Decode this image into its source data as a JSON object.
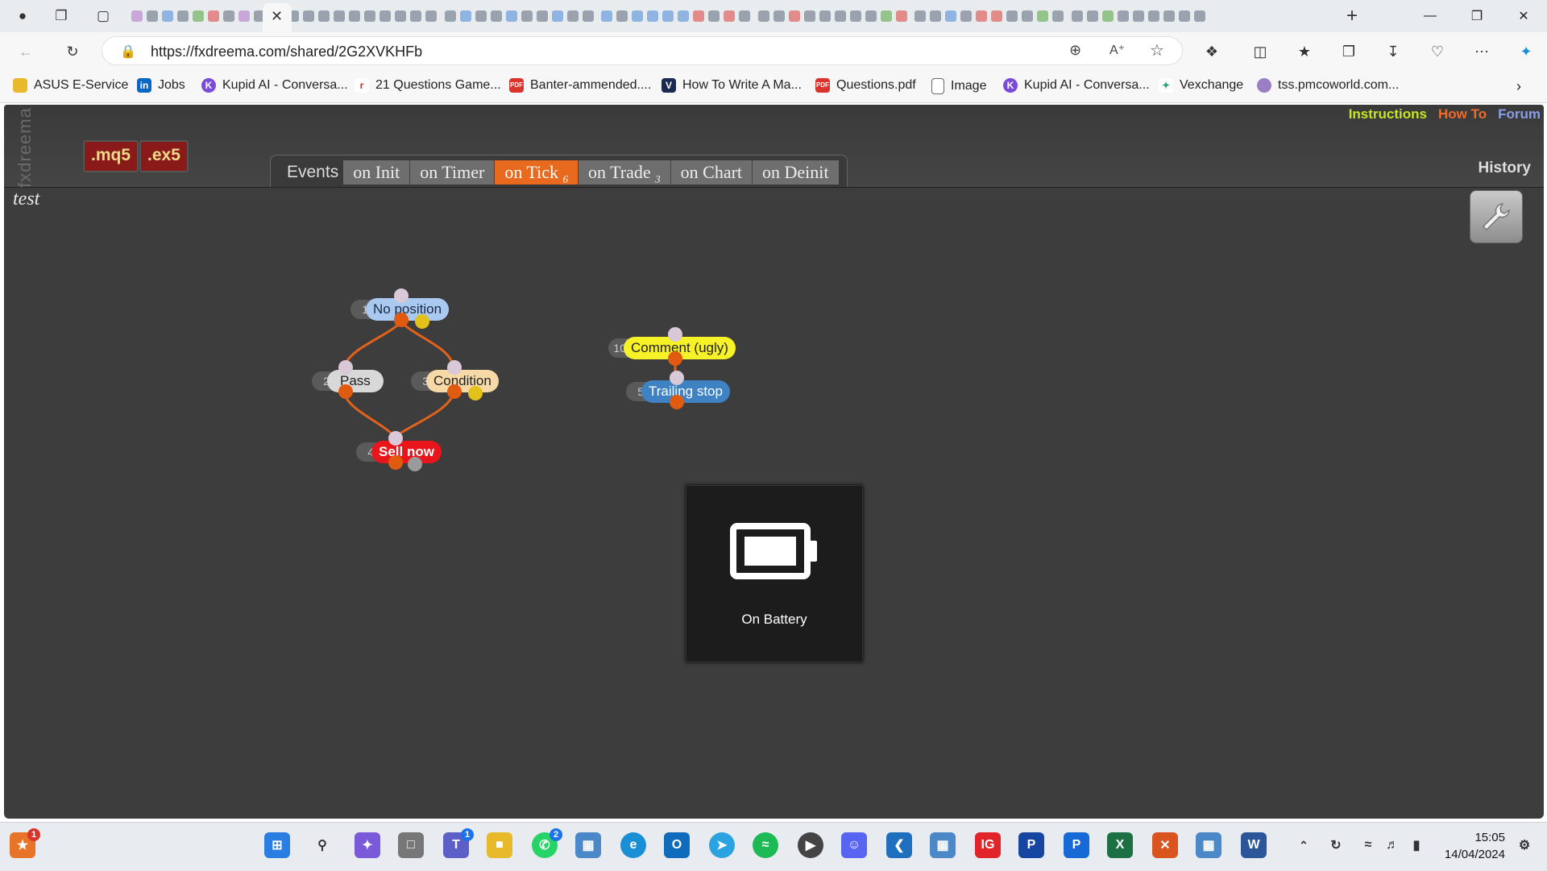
{
  "browser": {
    "url": "https://fxdreema.com/shared/2G2XVKHFb",
    "bookmarks": [
      {
        "label": "ASUS E-Service",
        "icon": "folder-icon",
        "color": "#e8b92b"
      },
      {
        "label": "Jobs",
        "icon": "linkedin-icon",
        "color": "#0a66c2"
      },
      {
        "label": "Kupid AI - Conversa...",
        "icon": "kupid-icon",
        "color": "#7a4ad8"
      },
      {
        "label": "21 Questions Game...",
        "icon": "site-icon",
        "color": "#c0392b"
      },
      {
        "label": "Banter-ammended....",
        "icon": "pdf-icon",
        "color": "#d9342b"
      },
      {
        "label": "How To Write A Ma...",
        "icon": "v-icon",
        "color": "#1b2a52"
      },
      {
        "label": "Questions.pdf",
        "icon": "pdf-icon",
        "color": "#d9342b"
      },
      {
        "label": "Image",
        "icon": "file-icon",
        "color": "#666666"
      },
      {
        "label": "Kupid AI - Conversa...",
        "icon": "kupid-icon",
        "color": "#7a4ad8"
      },
      {
        "label": "Vexchange",
        "icon": "vexchange-icon",
        "color": "#2ea36b"
      },
      {
        "label": "tss.pmcoworld.com...",
        "icon": "globe-icon",
        "color": "#9b7fc4"
      }
    ]
  },
  "app": {
    "brand": "fxdreema",
    "file_buttons": [
      ".mq5",
      ".ex5"
    ],
    "top_links": [
      {
        "label": "Instructions",
        "color": "#c8e620"
      },
      {
        "label": "How To",
        "color": "#f06a2a"
      },
      {
        "label": "Forum",
        "color": "#8a9ee8"
      }
    ],
    "history_label": "History",
    "events_label": "Events",
    "event_tabs": [
      {
        "label": "on Init",
        "count": ""
      },
      {
        "label": "on Timer",
        "count": ""
      },
      {
        "label": "on Tick",
        "count": "6",
        "active": true
      },
      {
        "label": "on Trade",
        "count": "3"
      },
      {
        "label": "on Chart",
        "count": ""
      },
      {
        "label": "on Deinit",
        "count": ""
      }
    ],
    "project_name": "test",
    "nodes": [
      {
        "num": "1",
        "label": "No position",
        "bg": "#a9c9f0",
        "fg": "#1a2a44"
      },
      {
        "num": "2",
        "label": "Pass",
        "bg": "#d8d8d8",
        "fg": "#222222"
      },
      {
        "num": "3",
        "label": "Condition",
        "bg": "#f7d9a8",
        "fg": "#222222"
      },
      {
        "num": "4",
        "label": "Sell now",
        "bg": "#e8161b",
        "fg": "#ffffff"
      },
      {
        "num": "10",
        "label": "Comment (ugly)",
        "bg": "#f7f227",
        "fg": "#222222"
      },
      {
        "num": "5",
        "label": "Trailing stop",
        "bg": "#3f82c4",
        "fg": "#ffffff"
      }
    ]
  },
  "battery_toast": {
    "label": "On Battery",
    "icon": "battery-icon"
  },
  "taskbar": {
    "time": "15:05",
    "date": "14/04/2024",
    "apps": [
      {
        "name": "notification-app-icon",
        "color": "#e8742a",
        "badge": "1"
      },
      {
        "name": "windows-start-icon",
        "color": "#2a7de1"
      },
      {
        "name": "search-icon",
        "color": "#333333"
      },
      {
        "name": "copilot-icon",
        "color": "#7a5ad8"
      },
      {
        "name": "task-view-icon",
        "color": "#555555"
      },
      {
        "name": "teams-icon",
        "color": "#5b5fc7",
        "badge": "1"
      },
      {
        "name": "file-explorer-icon",
        "color": "#e8b92b"
      },
      {
        "name": "whatsapp-icon",
        "color": "#25d366",
        "badge": "2"
      },
      {
        "name": "app-tile-icon",
        "color": "#4a88c8"
      },
      {
        "name": "edge-icon",
        "color": "#1b8fd6"
      },
      {
        "name": "outlook-icon",
        "color": "#0f6cbd"
      },
      {
        "name": "telegram-icon",
        "color": "#2aa3e0"
      },
      {
        "name": "spotify-icon",
        "color": "#1db954"
      },
      {
        "name": "media-player-icon",
        "color": "#444444"
      },
      {
        "name": "discord-icon",
        "color": "#5865f2"
      },
      {
        "name": "vscode-icon",
        "color": "#1f6fbf"
      },
      {
        "name": "app-tile-icon-2",
        "color": "#4a88c8"
      },
      {
        "name": "ig-icon",
        "color": "#e0242a"
      },
      {
        "name": "paypal-icon",
        "color": "#1746a2"
      },
      {
        "name": "paypal-icon-2",
        "color": "#1769d6"
      },
      {
        "name": "excel-icon",
        "color": "#1d7044"
      },
      {
        "name": "x-app-icon",
        "color": "#d9541e"
      },
      {
        "name": "app-tile-icon-3",
        "color": "#4a88c8"
      },
      {
        "name": "word-icon",
        "color": "#2b579a"
      }
    ]
  }
}
